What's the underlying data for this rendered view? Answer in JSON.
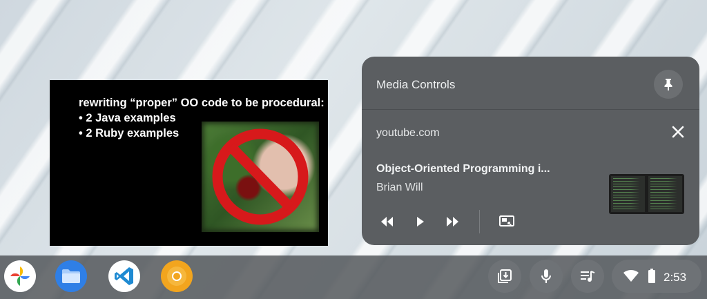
{
  "pip_video": {
    "slide_heading": "rewriting “proper” OO  code to be procedural:",
    "slide_bullets": [
      "• 2 Java examples",
      "• 2 Ruby examples"
    ]
  },
  "media_controls": {
    "title": "Media Controls",
    "source": "youtube.com",
    "track_title": "Object-Oriented Programming i...",
    "artist": "Brian Will",
    "icons": {
      "pin": "pin-icon",
      "close": "close-icon",
      "previous": "previous-track-icon",
      "play": "play-icon",
      "next": "next-track-icon",
      "pip": "picture-in-picture-icon"
    }
  },
  "shelf": {
    "apps": [
      {
        "name": "Google Photos",
        "icon": "photos-icon"
      },
      {
        "name": "Files",
        "icon": "files-icon"
      },
      {
        "name": "Visual Studio Code",
        "icon": "vscode-icon"
      },
      {
        "name": "Chrome Canary",
        "icon": "chrome-canary-icon"
      }
    ],
    "tray": [
      "holding-space-icon",
      "microphone-icon",
      "media-controls-icon"
    ],
    "status": {
      "wifi": "wifi-icon",
      "battery": "battery-icon",
      "time": "2:53"
    }
  },
  "colors": {
    "panel": "#5b5e61",
    "shelf": "#4e5256",
    "tray_button": "#6e7276",
    "ban_sign": "#d7191b"
  }
}
